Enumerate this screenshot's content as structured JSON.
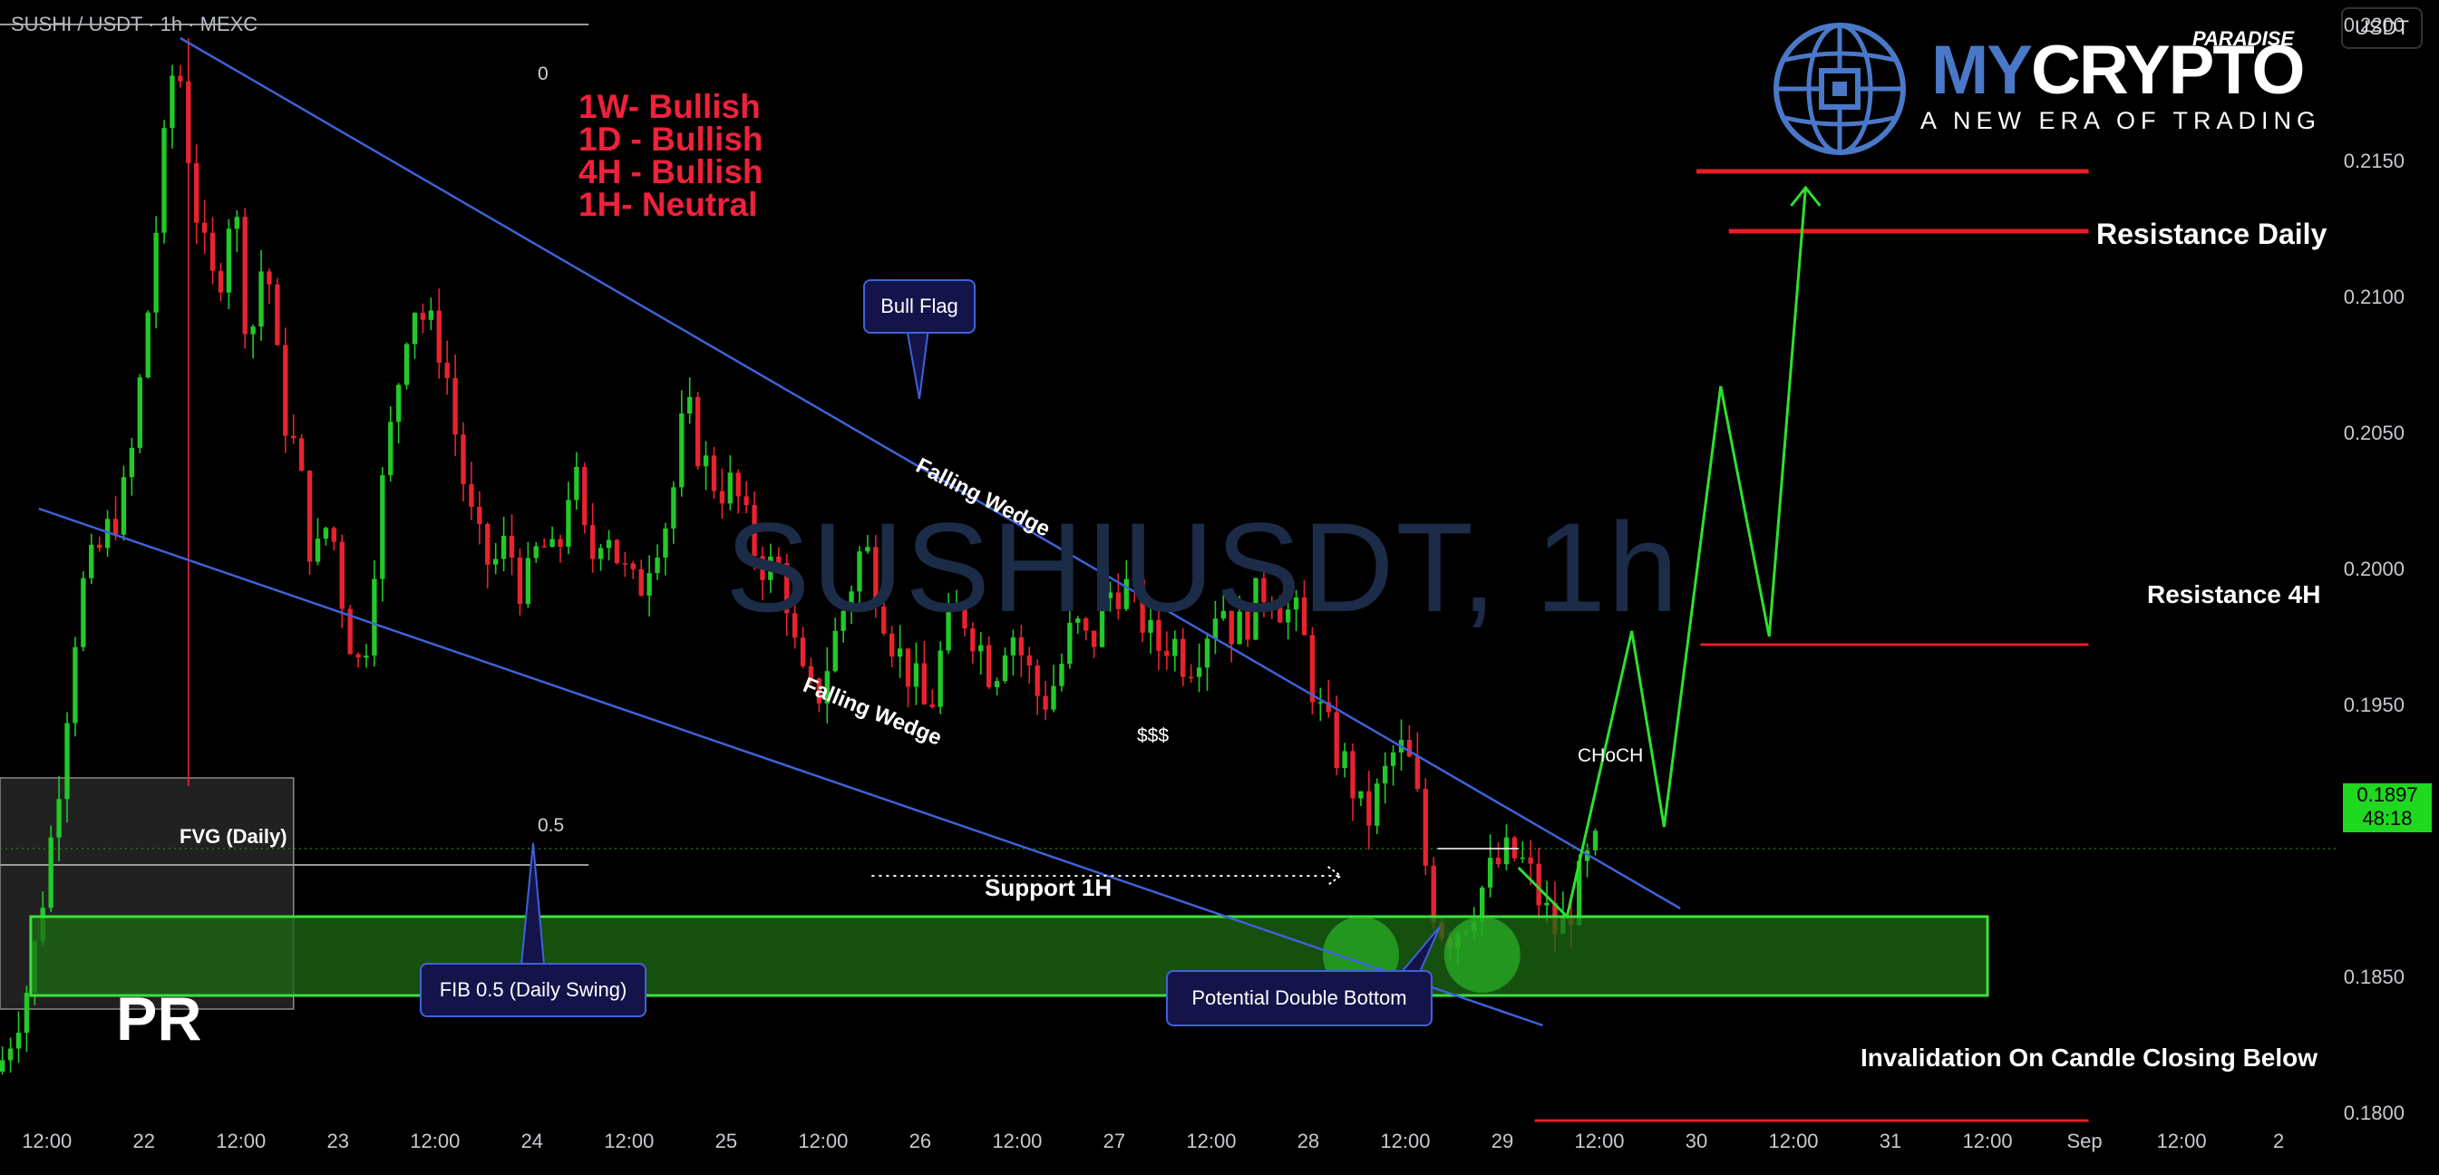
{
  "header": {
    "symbol_title": "SUSHI / USDT · 1h · MEXC",
    "currency_badge": "USDT",
    "watermark": "SUSHIUSDT, 1h"
  },
  "logo": {
    "brand_part1": "MY",
    "brand_part2": "CRYPTO",
    "superscript": "PARADISE",
    "tagline": "A NEW ERA OF TRADING"
  },
  "bias": [
    "1W- Bullish",
    "1D - Bullish",
    "4H - Bullish",
    "1H-  Neutral"
  ],
  "annotations": {
    "bull_flag": "Bull Flag",
    "falling_wedge_upper": "Falling Wedge",
    "falling_wedge_lower": "Falling Wedge",
    "dollars": "$$$",
    "choch": "CHoCH",
    "fvg": "FVG (Daily)",
    "support": "Support 1H",
    "fib_callout": "FIB 0.5 (Daily Swing)",
    "double_bottom": "Potential Double Bottom",
    "resistance_daily": "Resistance Daily",
    "resistance_4h": "Resistance 4H",
    "invalidation": "Invalidation On Candle Closing Below",
    "fib_0": "0",
    "fib_05": "0.5",
    "pr": "PR"
  },
  "current_price": {
    "price": "0.1897",
    "countdown": "48:18"
  },
  "colors": {
    "bull": "#22c928",
    "bear": "#e8232f",
    "trendline": "#3f62d8",
    "resistance": "#e51e26",
    "support_zone": "#1d6b14",
    "projection": "#2ee02e",
    "price_tag": "#1fd81f"
  },
  "chart_data": {
    "type": "candlestick",
    "symbol": "SUSHI / USDT",
    "timeframe": "1h",
    "y_axis": {
      "range": [
        0.1777,
        0.2209
      ],
      "ticks": [
        0.22,
        0.215,
        0.21,
        0.205,
        0.2,
        0.195,
        0.185,
        0.18
      ],
      "tick_labels": [
        "0.2200",
        "0.2150",
        "0.2100",
        "0.2050",
        "0.2000",
        "0.1950",
        "0.1850",
        "0.1800"
      ]
    },
    "x_axis": {
      "tick_labels": [
        "12:00",
        "22",
        "12:00",
        "23",
        "12:00",
        "24",
        "12:00",
        "25",
        "12:00",
        "26",
        "12:00",
        "27",
        "12:00",
        "28",
        "12:00",
        "29",
        "12:00",
        "30",
        "12:00",
        "31",
        "12:00",
        "Sep",
        "12:00",
        "2"
      ],
      "tick_hours": [
        -12,
        0,
        12,
        24,
        36,
        48,
        60,
        72,
        84,
        96,
        108,
        120,
        132,
        144,
        156,
        168,
        180,
        192,
        204,
        216,
        228,
        240,
        252,
        264
      ],
      "range_hours": [
        -17.8,
        271.5
      ],
      "hour_zero": "Aug 22 00:00"
    },
    "close_path": [
      [
        -18,
        0.1815
      ],
      [
        -14,
        0.185
      ],
      [
        -11,
        0.191
      ],
      [
        -8,
        0.199
      ],
      [
        -5,
        0.201
      ],
      [
        -2,
        0.203
      ],
      [
        0,
        0.208
      ],
      [
        2,
        0.214
      ],
      [
        4,
        0.2195
      ],
      [
        5,
        0.2165
      ],
      [
        7,
        0.212
      ],
      [
        9,
        0.21
      ],
      [
        11,
        0.214
      ],
      [
        13,
        0.208
      ],
      [
        15,
        0.212
      ],
      [
        17,
        0.206
      ],
      [
        19,
        0.204
      ],
      [
        21,
        0.2
      ],
      [
        23,
        0.202
      ],
      [
        25,
        0.198
      ],
      [
        27,
        0.196
      ],
      [
        29,
        0.202
      ],
      [
        31,
        0.206
      ],
      [
        33,
        0.21
      ],
      [
        35,
        0.209
      ],
      [
        37,
        0.208
      ],
      [
        39,
        0.204
      ],
      [
        41,
        0.201
      ],
      [
        43,
        0.2
      ],
      [
        45,
        0.201
      ],
      [
        47,
        0.199
      ],
      [
        49,
        0.201
      ],
      [
        51,
        0.2
      ],
      [
        53,
        0.204
      ],
      [
        55,
        0.2
      ],
      [
        57,
        0.202
      ],
      [
        59,
        0.2
      ],
      [
        61,
        0.199
      ],
      [
        63,
        0.201
      ],
      [
        65,
        0.202
      ],
      [
        67,
        0.206
      ],
      [
        69,
        0.204
      ],
      [
        71,
        0.203
      ],
      [
        73,
        0.203
      ],
      [
        75,
        0.201
      ],
      [
        77,
        0.2
      ],
      [
        79,
        0.2
      ],
      [
        81,
        0.196
      ],
      [
        83,
        0.195
      ],
      [
        85,
        0.197
      ],
      [
        87,
        0.199
      ],
      [
        89,
        0.201
      ],
      [
        91,
        0.199
      ],
      [
        93,
        0.197
      ],
      [
        95,
        0.196
      ],
      [
        97,
        0.1945
      ],
      [
        99,
        0.1975
      ],
      [
        101,
        0.1985
      ],
      [
        103,
        0.1975
      ],
      [
        105,
        0.196
      ],
      [
        107,
        0.198
      ],
      [
        109,
        0.1965
      ],
      [
        111,
        0.195
      ],
      [
        113,
        0.196
      ],
      [
        115,
        0.198
      ],
      [
        117,
        0.197
      ],
      [
        119,
        0.199
      ],
      [
        121,
        0.1995
      ],
      [
        123,
        0.1985
      ],
      [
        125,
        0.197
      ],
      [
        127,
        0.1975
      ],
      [
        129,
        0.1965
      ],
      [
        131,
        0.1975
      ],
      [
        133,
        0.199
      ],
      [
        135,
        0.1975
      ],
      [
        137,
        0.1985
      ],
      [
        139,
        0.1995
      ],
      [
        141,
        0.1985
      ],
      [
        143,
        0.198
      ],
      [
        145,
        0.195
      ],
      [
        147,
        0.1935
      ],
      [
        149,
        0.1925
      ],
      [
        151,
        0.1905
      ],
      [
        153,
        0.192
      ],
      [
        155,
        0.1935
      ],
      [
        157,
        0.1925
      ],
      [
        159,
        0.188
      ],
      [
        161,
        0.1865
      ],
      [
        163,
        0.187
      ],
      [
        165,
        0.188
      ],
      [
        167,
        0.189
      ],
      [
        169,
        0.1895
      ],
      [
        171,
        0.189
      ],
      [
        173,
        0.1875
      ],
      [
        175,
        0.1865
      ],
      [
        177,
        0.188
      ],
      [
        179,
        0.1895
      ],
      [
        180,
        0.1897
      ]
    ],
    "overlay_lines": {
      "wedge_upper": [
        [
          4.5,
          0.2195
        ],
        [
          190.0,
          0.1875
        ]
      ],
      "wedge_lower": [
        [
          -13.0,
          0.2022
        ],
        [
          173.0,
          0.1832
        ]
      ],
      "fib_0": {
        "price": 0.22,
        "hours": [
          -17.8,
          55.0
        ]
      },
      "fib_05": {
        "price": 0.1891,
        "hours": [
          -17.8,
          55.0
        ]
      },
      "fvg_zone": {
        "price": [
          0.1838,
          0.1923
        ],
        "hours": [
          -17.8,
          18.5
        ]
      },
      "support_1h": {
        "price": [
          0.1843,
          0.1872
        ],
        "hours": [
          -14.0,
          228.0
        ]
      },
      "resistance_daily": {
        "price": [
          0.2146,
          0.2124
        ],
        "hours": [
          [
            192.0,
            240.5
          ],
          [
            196.0,
            240.5
          ]
        ]
      },
      "resistance_4h": {
        "price": 0.1972,
        "hours": [
          192.5,
          240.5
        ]
      },
      "invalidation": {
        "price": 0.1797,
        "hours": [
          172.0,
          240.5
        ]
      },
      "liquidity_dotted": {
        "price": 0.1887,
        "hours": [
          90.0,
          148.0
        ]
      },
      "choch": {
        "price": 0.1897,
        "hours": [
          160.0,
          170.0
        ]
      },
      "double_bottom_circles": [
        [
          150.5,
          0.1858
        ],
        [
          165.5,
          0.1858
        ]
      ]
    },
    "projection_path": [
      [
        170.0,
        0.189
      ],
      [
        176.0,
        0.1872
      ],
      [
        184.0,
        0.1977
      ],
      [
        188.0,
        0.1905
      ],
      [
        195.0,
        0.2067
      ],
      [
        201.0,
        0.1975
      ],
      [
        205.5,
        0.214
      ]
    ]
  }
}
